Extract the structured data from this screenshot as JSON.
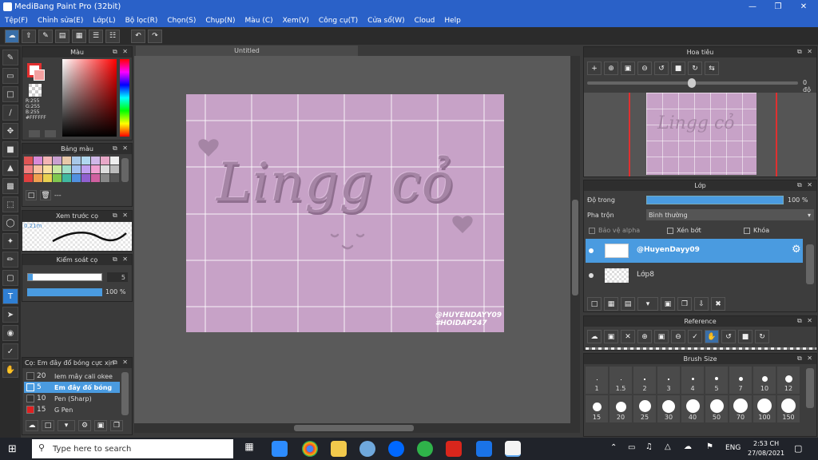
{
  "window": {
    "title": "MediBang Paint Pro (32bit)"
  },
  "menu": [
    "Tệp(F)",
    "Chỉnh sửa(E)",
    "Lớp(L)",
    "Bộ lọc(R)",
    "Chọn(S)",
    "Chụp(N)",
    "Màu (C)",
    "Xem(V)",
    "Công cụ(T)",
    "Cửa sổ(W)",
    "Cloud",
    "Help"
  ],
  "panels": {
    "color": {
      "title": "Màu",
      "r": "R:255",
      "g": "G:255",
      "b": "B:255",
      "hex": "#FFFFFF"
    },
    "palette": {
      "title": "Bảng màu",
      "dash": "---"
    },
    "brush_preview": {
      "title": "Xem trước cọ",
      "size": "0.21m"
    },
    "brush_control": {
      "title": "Kiểm soát cọ",
      "size_value": "5",
      "opacity_value": "100 %"
    },
    "brush_list": {
      "title": "Cọ: Em đây đổ bóng cực xịn",
      "items": [
        {
          "size": "20",
          "name": "Iem mây cali okee",
          "color": "#333333"
        },
        {
          "size": "5",
          "name": "Em đây đổ bóng",
          "color": "#4a9be0",
          "selected": true
        },
        {
          "size": "10",
          "name": "Pen (Sharp)",
          "color": "#333333"
        },
        {
          "size": "15",
          "name": "G Pen",
          "color": "#e02020"
        }
      ]
    },
    "navigator": {
      "title": "Hoa tiêu",
      "angle": "0 độ"
    },
    "layers": {
      "title": "Lớp",
      "opacity_label": "Độ trong",
      "opacity_value": "100 %",
      "blend_label": "Pha trộn",
      "blend_value": "Bình thường",
      "protect_alpha": "Bảo vệ alpha",
      "clip": "Xén bớt",
      "lock": "Khóa",
      "items": [
        {
          "name": "@HuyenDayy09",
          "selected": true
        },
        {
          "name": "Lớp8",
          "selected": false
        }
      ]
    },
    "reference": {
      "title": "Reference"
    },
    "brush_size": {
      "title": "Brush Size",
      "row1": [
        "1",
        "1.5",
        "2",
        "3",
        "4",
        "5",
        "7",
        "10",
        "12"
      ],
      "row2": [
        "15",
        "20",
        "25",
        "30",
        "40",
        "50",
        "70",
        "100",
        "150"
      ]
    }
  },
  "document": {
    "tab": "Untitled",
    "art_text": "Lingg cỏ",
    "watermark1": "@HUYENDAYY09",
    "watermark2": "#HOIDAP247"
  },
  "taskbar": {
    "search_placeholder": "Type here to search",
    "lang": "ENG",
    "time": "2:53 CH",
    "date": "27/08/2021"
  }
}
